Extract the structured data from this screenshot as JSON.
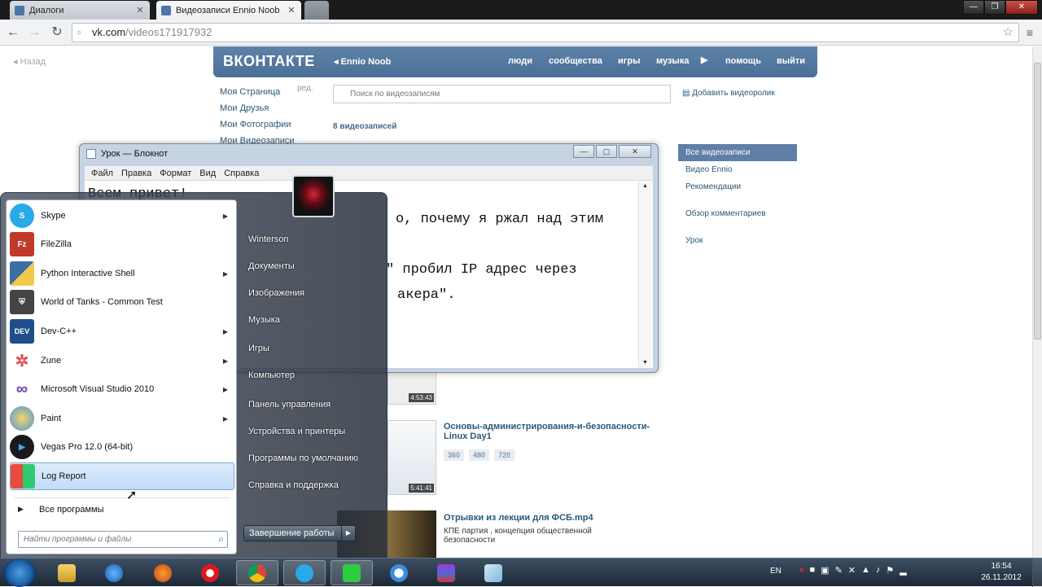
{
  "browser": {
    "tabs": [
      {
        "label": "Диалоги",
        "active": false
      },
      {
        "label": "Видеозаписи Ennio Noob",
        "active": true
      }
    ],
    "url_host": "vk.com",
    "url_path": "/videos171917932"
  },
  "vk": {
    "back_label": "Назад",
    "logo": "ВКОНТАКТЕ",
    "user": "Ennio Noob",
    "nav": [
      "люди",
      "сообщества",
      "игры",
      "музыка",
      "помощь",
      "выйти"
    ],
    "left_menu": [
      "Моя Страница",
      "Мои Друзья",
      "Мои Фотографии",
      "Мои Видеозаписи"
    ],
    "edit_label": "ред.",
    "search_placeholder": "Поиск по видеозаписям",
    "add_video": "Добавить видеоролик",
    "video_count": "8 видеозаписей",
    "right_menu": [
      "Все видеозаписи",
      "Видео Ennio",
      "Рекомендации",
      "Обзор комментариев",
      "Урок"
    ],
    "videos": [
      {
        "duration": "4:53:43"
      },
      {
        "title": "Основы-администрирования-и-безопасности-Linux Day1",
        "duration": "5:41:41",
        "qualities": [
          "360",
          "480",
          "720"
        ]
      },
      {
        "title": "Отрывки из лекции для ФСБ.mp4",
        "desc": "КПЕ партия , концепция общественной безопасности"
      }
    ]
  },
  "notepad": {
    "title": "Урок — Блокнот",
    "menu": [
      "Файл",
      "Правка",
      "Формат",
      "Вид",
      "Справка"
    ],
    "lines": [
      "Всем привет!",
      "",
      "",
      "",
      "",
      ""
    ],
    "visible_lines": [
      "о, почему я ржал над этим",
      "",
      "",
      "\" пробил IP адрес через",
      "акера\"."
    ]
  },
  "startmenu": {
    "programs": [
      {
        "label": "Skype",
        "icon": "skype-icon",
        "arrow": true,
        "color": "#2aa9e8"
      },
      {
        "label": "FileZilla",
        "icon": "filezilla-icon",
        "arrow": false,
        "color": "#c0392b"
      },
      {
        "label": "Python Interactive Shell",
        "icon": "python-icon",
        "arrow": true,
        "color": "#3a6ea5"
      },
      {
        "label": "World of Tanks - Common Test",
        "icon": "wot-icon",
        "arrow": false,
        "color": "#444"
      },
      {
        "label": "Dev-C++",
        "icon": "devcpp-icon",
        "arrow": true,
        "color": "#1f4e8c"
      },
      {
        "label": "Zune",
        "icon": "zune-icon",
        "arrow": true,
        "color": "#d9534f"
      },
      {
        "label": "Microsoft Visual Studio 2010",
        "icon": "vs-icon",
        "arrow": true,
        "color": "#6a3fa0"
      },
      {
        "label": "Paint",
        "icon": "paint-icon",
        "arrow": true,
        "color": "#4a90d9"
      },
      {
        "label": "Vegas Pro 12.0 (64-bit)",
        "icon": "vegas-icon",
        "arrow": false,
        "color": "#1a1a1a"
      },
      {
        "label": "Log Report",
        "icon": "windows-flag-icon",
        "arrow": false,
        "color": "#e74c3c",
        "highlighted": true
      }
    ],
    "all_programs": "Все программы",
    "search_placeholder": "Найти программы и файлы",
    "right_items": [
      "Winterson",
      "Документы",
      "Изображения",
      "Музыка",
      "Игры",
      "Компьютер",
      "Панель управления",
      "Устройства и принтеры",
      "Программы по умолчанию",
      "Справка и поддержка"
    ],
    "shutdown": "Завершение работы"
  },
  "taskbar": {
    "lang": "EN",
    "time": "16:54",
    "date": "26.11.2012"
  }
}
